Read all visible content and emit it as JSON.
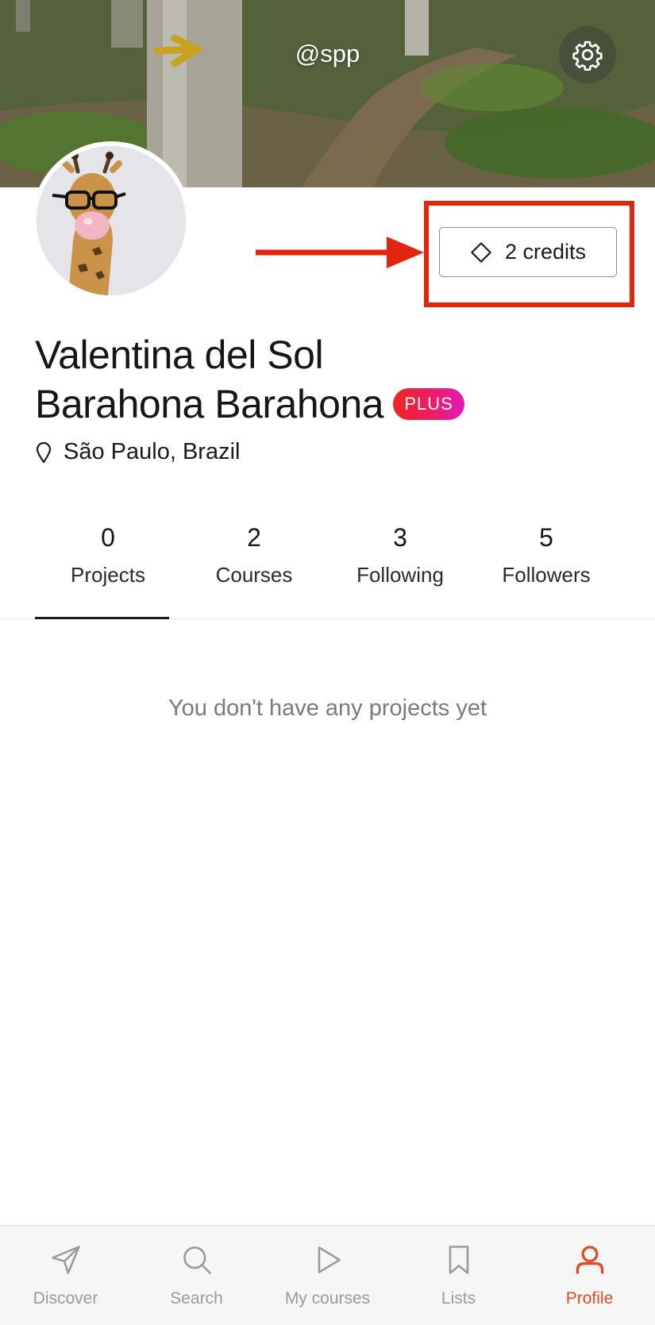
{
  "header": {
    "username": "@spp",
    "settings_icon": "gear-icon"
  },
  "profile": {
    "name_line1": "Valentina del Sol",
    "name_line2": "Barahona Barahona",
    "badge": "PLUS",
    "location": "São Paulo, Brazil",
    "credits_label": "2 credits"
  },
  "stats": [
    {
      "value": "0",
      "label": "Projects"
    },
    {
      "value": "2",
      "label": "Courses"
    },
    {
      "value": "3",
      "label": "Following"
    },
    {
      "value": "5",
      "label": "Followers"
    }
  ],
  "empty_state": "You don't have any projects yet",
  "bottom_nav": [
    {
      "label": "Discover",
      "icon": "send-icon"
    },
    {
      "label": "Search",
      "icon": "search-icon"
    },
    {
      "label": "My courses",
      "icon": "play-icon"
    },
    {
      "label": "Lists",
      "icon": "bookmark-icon"
    },
    {
      "label": "Profile",
      "icon": "user-icon"
    }
  ],
  "colors": {
    "accent": "#e24b1f",
    "annotation_red": "#e2260d",
    "badge_gradient_start": "#f0241f",
    "badge_gradient_end": "#e11bbb"
  }
}
